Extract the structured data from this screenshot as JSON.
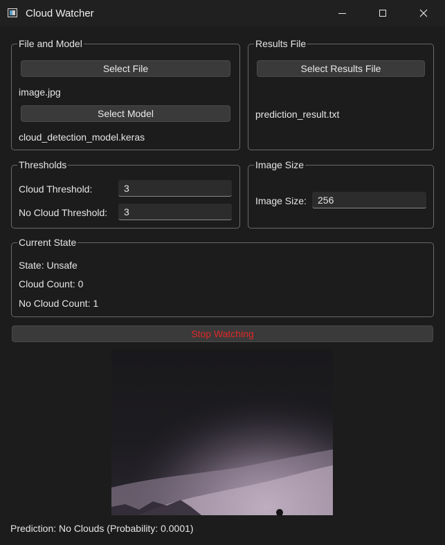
{
  "window": {
    "title": "Cloud Watcher"
  },
  "file_model": {
    "legend": "File and Model",
    "select_file_label": "Select File",
    "file_name": "image.jpg",
    "select_model_label": "Select Model",
    "model_name": "cloud_detection_model.keras"
  },
  "results": {
    "legend": "Results File",
    "select_results_label": "Select Results File",
    "results_name": "prediction_result.txt"
  },
  "thresholds": {
    "legend": "Thresholds",
    "cloud_label": "Cloud Threshold:",
    "cloud_value": "3",
    "no_cloud_label": "No Cloud Threshold:",
    "no_cloud_value": "3"
  },
  "image_size": {
    "legend": "Image Size",
    "label": "Image Size:",
    "value": "256"
  },
  "current_state": {
    "legend": "Current State",
    "state": "State: Unsafe",
    "cloud_count": "Cloud Count: 0",
    "no_cloud_count": "No Cloud Count: 1"
  },
  "controls": {
    "stop_label": "Stop Watching"
  },
  "prediction": {
    "text": "Prediction: No Clouds (Probability: 0.0001)"
  },
  "colors": {
    "stop_text": "#e02828",
    "background": "#1c1c1c"
  }
}
